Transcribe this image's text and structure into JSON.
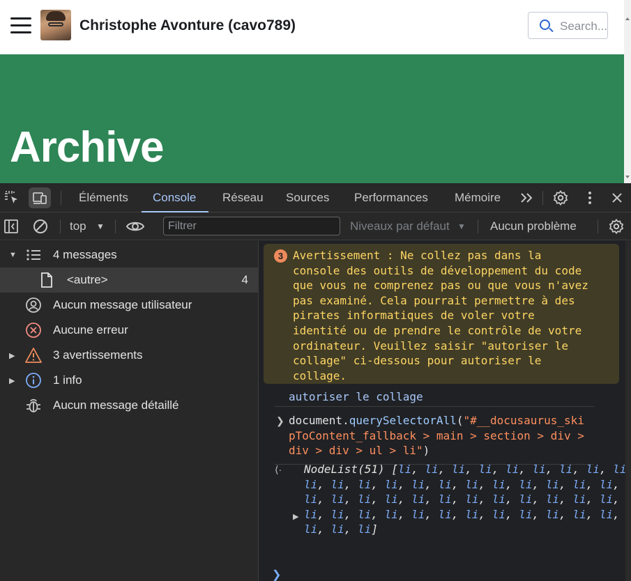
{
  "site": {
    "title": "Christophe Avonture (cavo789)",
    "search_placeholder": "Search...",
    "hero_title": "Archive",
    "brand_color": "#2e8555"
  },
  "devtools": {
    "tabs": [
      {
        "label": "Éléments"
      },
      {
        "label": "Console",
        "active": true
      },
      {
        "label": "Réseau"
      },
      {
        "label": "Sources"
      },
      {
        "label": "Performances"
      },
      {
        "label": "Mémoire"
      }
    ],
    "toolbar": {
      "context": "top",
      "filter_placeholder": "Filtrer",
      "levels": "Niveaux par défaut",
      "issues": "Aucun problème"
    },
    "sidebar": {
      "items": [
        {
          "label": "4 messages",
          "icon": "list-icon"
        },
        {
          "label": "<autre>",
          "count": "4",
          "icon": "file-icon"
        },
        {
          "label": "Aucun message utilisateur",
          "icon": "user-icon"
        },
        {
          "label": "Aucune erreur",
          "icon": "error-icon"
        },
        {
          "label": "3 avertissements",
          "icon": "warning-icon"
        },
        {
          "label": "1 info",
          "icon": "info-icon"
        },
        {
          "label": "Aucun message détaillé",
          "icon": "bug-icon"
        }
      ]
    },
    "console": {
      "warning_count": "3",
      "warning_text": "Avertissement : Ne collez pas dans la\nconsole des outils de développement du code\nque vous ne comprenez pas ou que vous n'avez\npas examiné. Cela pourrait permettre à des\npirates informatiques de voler votre\nidentité ou de prendre le contrôle de votre\nordinateur. Veuillez saisir \"autoriser le\ncollage\" ci-dessous pour autoriser le\ncollage.",
      "echo": "autoriser le collage",
      "command": {
        "object": "document.",
        "method": "querySelectorAll",
        "open": "(",
        "string_line1": "\"#__docusaurus_ski",
        "string_line2": "pToContent_fallback > main > section > div >",
        "string_line3": "div > div > ul > li\"",
        "close": ")"
      },
      "result": {
        "prefix": "NodeList(51) [",
        "item": "li",
        "count": 51,
        "suffix": "]"
      }
    }
  }
}
